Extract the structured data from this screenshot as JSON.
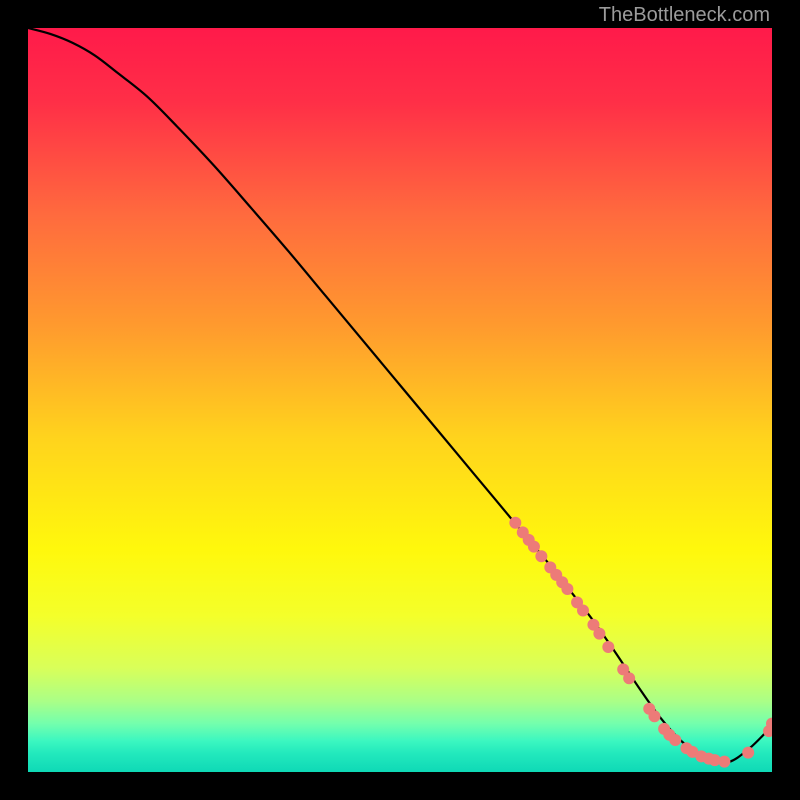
{
  "watermark": "TheBottleneck.com",
  "chart_data": {
    "type": "line",
    "title": "",
    "xlabel": "",
    "ylabel": "",
    "xlim": [
      0,
      100
    ],
    "ylim": [
      0,
      100
    ],
    "background_gradient": {
      "stops": [
        {
          "pos": 0.0,
          "color": "#ff1a4a"
        },
        {
          "pos": 0.1,
          "color": "#ff2f47"
        },
        {
          "pos": 0.25,
          "color": "#ff6a3e"
        },
        {
          "pos": 0.4,
          "color": "#ff9a2e"
        },
        {
          "pos": 0.55,
          "color": "#ffd31d"
        },
        {
          "pos": 0.7,
          "color": "#fff80c"
        },
        {
          "pos": 0.79,
          "color": "#f4ff2a"
        },
        {
          "pos": 0.86,
          "color": "#d9ff59"
        },
        {
          "pos": 0.905,
          "color": "#aaff87"
        },
        {
          "pos": 0.935,
          "color": "#73ffad"
        },
        {
          "pos": 0.958,
          "color": "#3cf7c0"
        },
        {
          "pos": 0.975,
          "color": "#22e9bd"
        },
        {
          "pos": 1.0,
          "color": "#0fd9b6"
        }
      ]
    },
    "series": [
      {
        "name": "bottleneck-curve",
        "type": "line",
        "color": "#000000",
        "x": [
          0,
          3,
          6,
          9,
          12,
          16,
          20,
          25,
          30,
          35,
          40,
          45,
          50,
          55,
          60,
          65,
          70,
          73,
          76,
          79,
          82,
          85,
          88,
          91,
          94,
          97,
          100
        ],
        "y": [
          100,
          99.2,
          98.0,
          96.3,
          94.0,
          90.8,
          86.8,
          81.5,
          75.8,
          70.0,
          64.0,
          58.0,
          52.0,
          46.0,
          40.0,
          34.0,
          28.0,
          24.2,
          20.3,
          16.0,
          11.5,
          7.3,
          4.0,
          2.0,
          1.3,
          3.2,
          6.2
        ]
      },
      {
        "name": "highlight-dots",
        "type": "scatter",
        "color": "#ed7b78",
        "points": [
          {
            "x": 65.5,
            "y": 33.5
          },
          {
            "x": 66.5,
            "y": 32.2
          },
          {
            "x": 67.3,
            "y": 31.2
          },
          {
            "x": 68.0,
            "y": 30.3
          },
          {
            "x": 69.0,
            "y": 29.0
          },
          {
            "x": 70.2,
            "y": 27.5
          },
          {
            "x": 71.0,
            "y": 26.5
          },
          {
            "x": 71.8,
            "y": 25.5
          },
          {
            "x": 72.5,
            "y": 24.6
          },
          {
            "x": 73.8,
            "y": 22.8
          },
          {
            "x": 74.6,
            "y": 21.7
          },
          {
            "x": 76.0,
            "y": 19.8
          },
          {
            "x": 76.8,
            "y": 18.6
          },
          {
            "x": 78.0,
            "y": 16.8
          },
          {
            "x": 80.0,
            "y": 13.8
          },
          {
            "x": 80.8,
            "y": 12.6
          },
          {
            "x": 83.5,
            "y": 8.5
          },
          {
            "x": 84.2,
            "y": 7.5
          },
          {
            "x": 85.5,
            "y": 5.8
          },
          {
            "x": 86.2,
            "y": 5.0
          },
          {
            "x": 87.0,
            "y": 4.3
          },
          {
            "x": 88.5,
            "y": 3.2
          },
          {
            "x": 89.3,
            "y": 2.7
          },
          {
            "x": 90.5,
            "y": 2.1
          },
          {
            "x": 91.5,
            "y": 1.8
          },
          {
            "x": 92.3,
            "y": 1.6
          },
          {
            "x": 93.6,
            "y": 1.4
          },
          {
            "x": 96.8,
            "y": 2.6
          },
          {
            "x": 99.6,
            "y": 5.5
          },
          {
            "x": 100.0,
            "y": 6.5
          }
        ]
      }
    ]
  }
}
